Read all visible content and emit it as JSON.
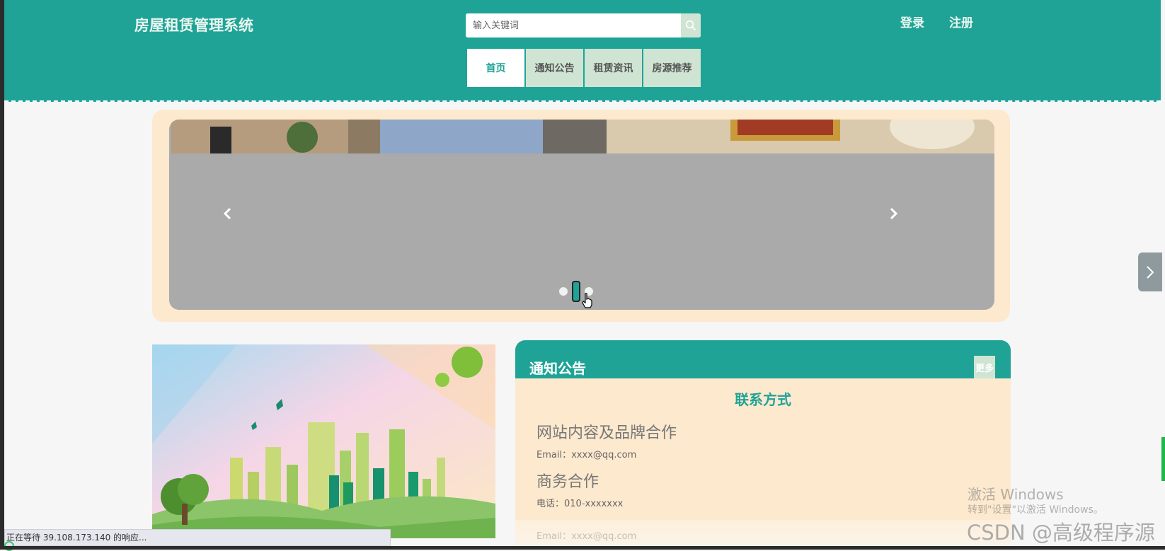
{
  "header": {
    "site_title": "房屋租赁管理系统",
    "search": {
      "placeholder": "输入关键词",
      "value": ""
    },
    "login_label": "登录",
    "register_label": "注册"
  },
  "nav": {
    "items": [
      {
        "label": "首页",
        "active": true
      },
      {
        "label": "通知公告",
        "active": false
      },
      {
        "label": "租赁资讯",
        "active": false
      },
      {
        "label": "房源推荐",
        "active": false
      }
    ]
  },
  "carousel": {
    "slide_count": 3,
    "active_index": 1
  },
  "notice": {
    "title": "通知公告",
    "more_label": "更多",
    "contact": {
      "heading": "联系方式",
      "sections": [
        {
          "title": "网站内容及品牌合作",
          "line": "Email：xxxx@qq.com"
        },
        {
          "title": "商务合作",
          "line": "电话：010-xxxxxxx"
        }
      ],
      "faded_line": "Email：xxxx@qq.com"
    }
  },
  "watermark": {
    "activate_title": "激活 Windows",
    "activate_hint": "转到\"设置\"以激活 Windows。",
    "csdn": "CSDN @高级程序源"
  },
  "status_bar": {
    "text": "正在等待 39.108.173.140 的响应..."
  },
  "colors": {
    "primary": "#1fa397",
    "nav_bg": "#cfe4d3",
    "panel_bg": "#fde9ce"
  }
}
